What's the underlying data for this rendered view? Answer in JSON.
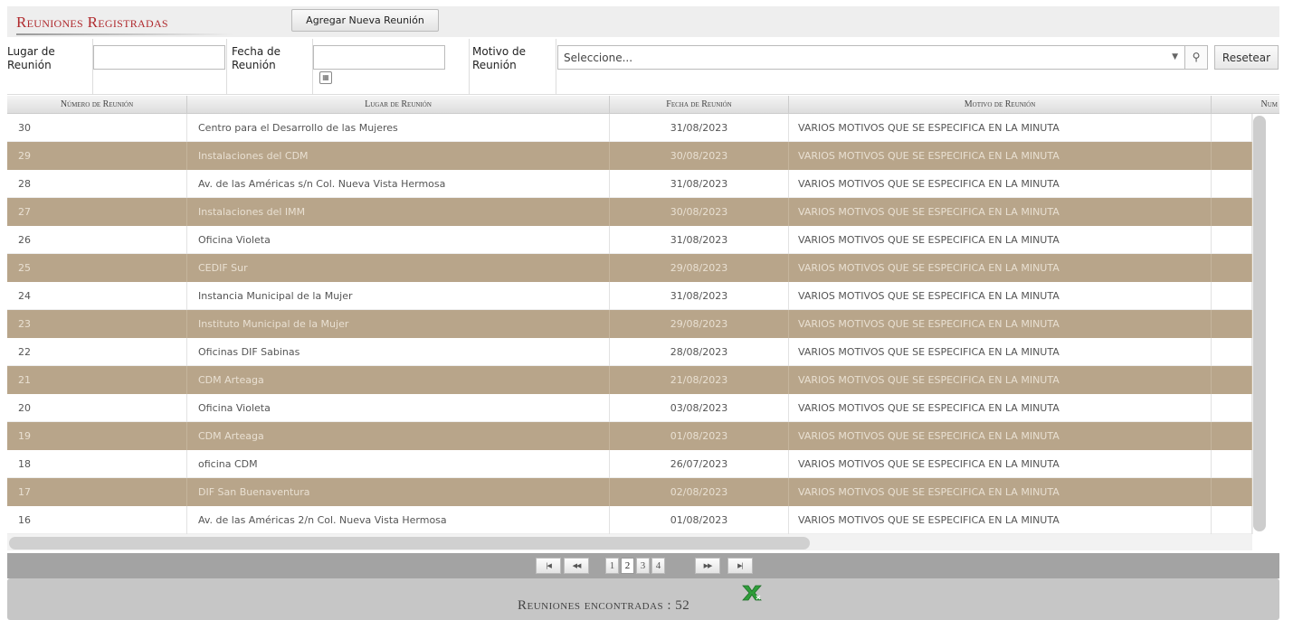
{
  "header": {
    "title": "Reuniones Registradas",
    "add_button": "Agregar Nueva Reunión"
  },
  "filters": {
    "lugar_label": "Lugar de Reunión",
    "lugar_value": "",
    "fecha_label": "Fecha de Reunión",
    "fecha_value": "",
    "motivo_label": "Motivo de Reunión",
    "motivo_selected": "Seleccione...",
    "reset_button": "Resetear"
  },
  "table": {
    "columns": [
      "Número de Reunión",
      "Lugar de Reunión",
      "Fecha de Reunión",
      "Motivo de Reunión",
      "Num"
    ],
    "rows": [
      {
        "numero": "30",
        "lugar": "Centro para el Desarrollo de las Mujeres",
        "fecha": "31/08/2023",
        "motivo": "VARIOS MOTIVOS QUE SE ESPECIFICA EN LA MINUTA"
      },
      {
        "numero": "29",
        "lugar": "Instalaciones del CDM",
        "fecha": "30/08/2023",
        "motivo": "VARIOS MOTIVOS QUE SE ESPECIFICA EN LA MINUTA"
      },
      {
        "numero": "28",
        "lugar": "Av. de las Américas s/n Col. Nueva Vista Hermosa",
        "fecha": "31/08/2023",
        "motivo": "VARIOS MOTIVOS QUE SE ESPECIFICA EN LA MINUTA"
      },
      {
        "numero": "27",
        "lugar": "Instalaciones del IMM",
        "fecha": "30/08/2023",
        "motivo": "VARIOS MOTIVOS QUE SE ESPECIFICA EN LA MINUTA"
      },
      {
        "numero": "26",
        "lugar": "Oficina Violeta",
        "fecha": "31/08/2023",
        "motivo": "VARIOS MOTIVOS QUE SE ESPECIFICA EN LA MINUTA"
      },
      {
        "numero": "25",
        "lugar": "CEDIF Sur",
        "fecha": "29/08/2023",
        "motivo": "VARIOS MOTIVOS QUE SE ESPECIFICA EN LA MINUTA"
      },
      {
        "numero": "24",
        "lugar": "Instancia Municipal de la Mujer",
        "fecha": "31/08/2023",
        "motivo": "VARIOS MOTIVOS QUE SE ESPECIFICA EN LA MINUTA"
      },
      {
        "numero": "23",
        "lugar": "Instituto Municipal de la Mujer",
        "fecha": "29/08/2023",
        "motivo": "VARIOS MOTIVOS QUE SE ESPECIFICA EN LA MINUTA"
      },
      {
        "numero": "22",
        "lugar": "Oficinas DIF Sabinas",
        "fecha": "28/08/2023",
        "motivo": "VARIOS MOTIVOS QUE SE ESPECIFICA EN LA MINUTA"
      },
      {
        "numero": "21",
        "lugar": "CDM Arteaga",
        "fecha": "21/08/2023",
        "motivo": "VARIOS MOTIVOS QUE SE ESPECIFICA EN LA MINUTA"
      },
      {
        "numero": "20",
        "lugar": "Oficina Violeta",
        "fecha": "03/08/2023",
        "motivo": "VARIOS MOTIVOS QUE SE ESPECIFICA EN LA MINUTA"
      },
      {
        "numero": "19",
        "lugar": "CDM Arteaga",
        "fecha": "01/08/2023",
        "motivo": "VARIOS MOTIVOS QUE SE ESPECIFICA EN LA MINUTA"
      },
      {
        "numero": "18",
        "lugar": "oficina CDM",
        "fecha": "26/07/2023",
        "motivo": "VARIOS MOTIVOS QUE SE ESPECIFICA EN LA MINUTA"
      },
      {
        "numero": "17",
        "lugar": "DIF San Buenaventura",
        "fecha": "02/08/2023",
        "motivo": "VARIOS MOTIVOS QUE SE ESPECIFICA EN LA MINUTA"
      },
      {
        "numero": "16",
        "lugar": "Av. de las Américas 2/n Col. Nueva Vista Hermosa",
        "fecha": "01/08/2023",
        "motivo": "VARIOS MOTIVOS QUE SE ESPECIFICA EN LA MINUTA"
      }
    ]
  },
  "pager": {
    "pages": [
      "1",
      "2",
      "3",
      "4"
    ],
    "current": "2",
    "first_icon": "first-page-icon",
    "prev_icon": "previous-page-icon",
    "next_icon": "next-page-icon",
    "last_icon": "last-page-icon"
  },
  "footer": {
    "count_text": "Reuniones encontradas : 52",
    "export_icon": "excel-export-icon"
  },
  "colors": {
    "title": "#b02a2e",
    "alt_row": "#b8a58a",
    "pager_bar": "#a3a3a3",
    "footer": "#c6c6c6",
    "excel_green": "#2e9e3a"
  }
}
